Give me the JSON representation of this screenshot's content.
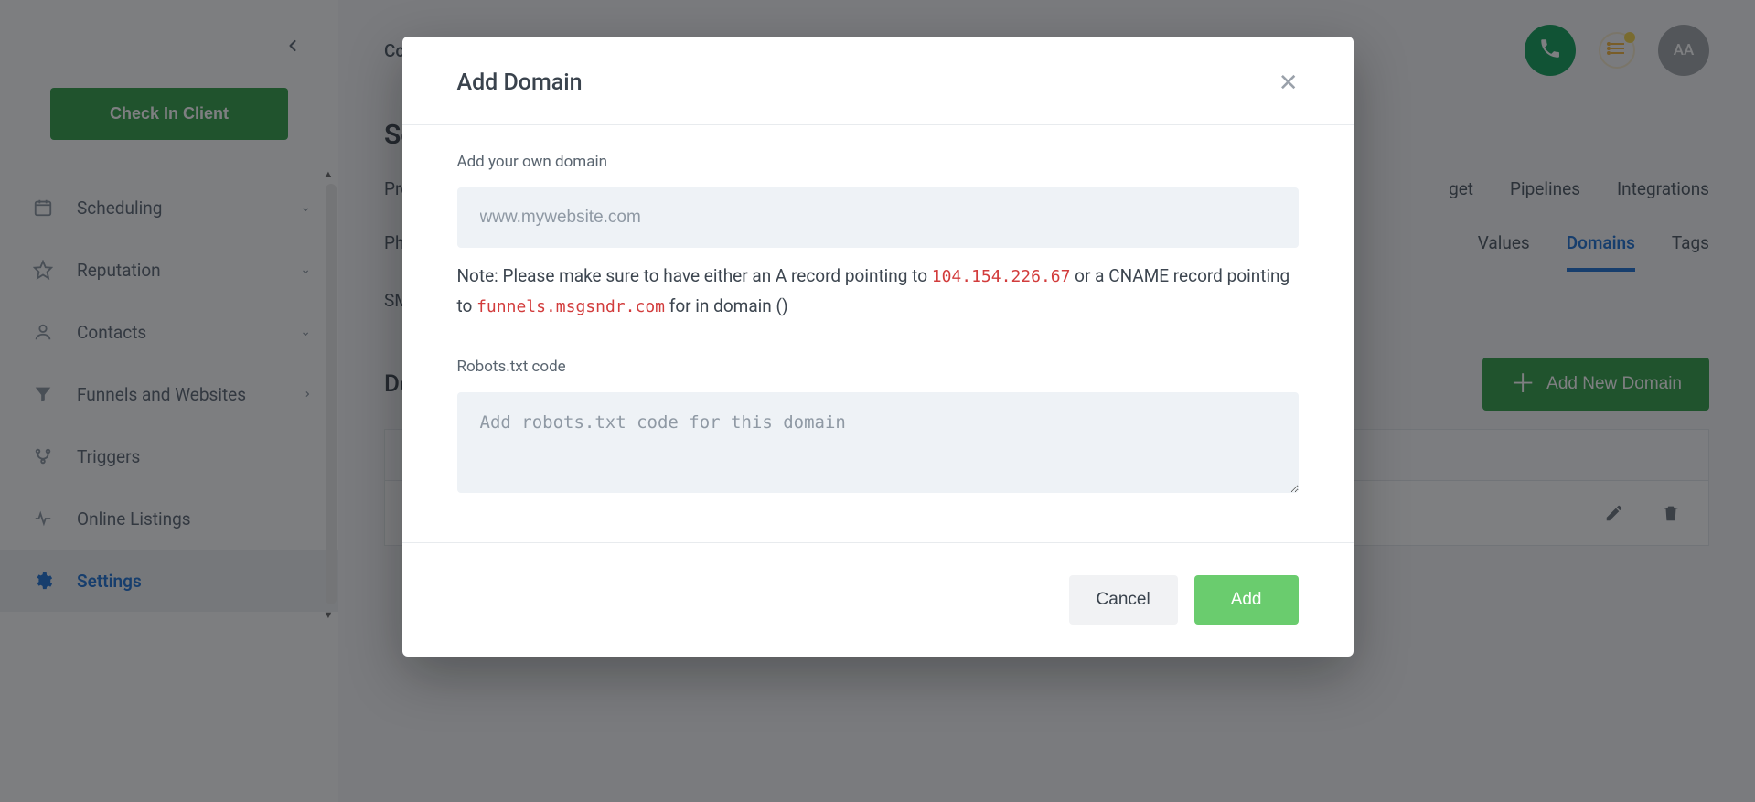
{
  "sidebar": {
    "check_in_label": "Check In Client",
    "items": [
      {
        "icon": "calendar",
        "label": "Scheduling",
        "expandable": true
      },
      {
        "icon": "star",
        "label": "Reputation",
        "expandable": true
      },
      {
        "icon": "person",
        "label": "Contacts",
        "expandable": true
      },
      {
        "icon": "funnel",
        "label": "Funnels and Websites",
        "expandable": true,
        "chevron": "right"
      },
      {
        "icon": "branch",
        "label": "Triggers",
        "expandable": false
      },
      {
        "icon": "pulse",
        "label": "Online Listings",
        "expandable": false
      },
      {
        "icon": "gear",
        "label": "Settings",
        "expandable": false,
        "active": true
      }
    ]
  },
  "header": {
    "breadcrumb": "Co",
    "avatar_initials": "AA"
  },
  "page": {
    "title_prefix": "Set",
    "section_title_prefix": "Do",
    "tabs_row1": [
      "Profi",
      "get",
      "Pipelines",
      "Integrations"
    ],
    "tabs_row2": [
      "Phon",
      " Values",
      "Domains",
      "Tags"
    ],
    "active_tab": "Domains",
    "tabs_row3": [
      "SMT"
    ],
    "add_domain_btn": "Add New Domain"
  },
  "modal": {
    "title": "Add Domain",
    "domain_field_label": "Add your own domain",
    "domain_placeholder": "www.mywebsite.com",
    "note_prefix": "Note: Please make sure to have either an A record pointing to ",
    "note_ip": "104.154.226.67",
    "note_mid": " or a CNAME record pointing to ",
    "note_cname": "funnels.msgsndr.com",
    "note_suffix": " for in domain ()",
    "robots_label": "Robots.txt code",
    "robots_placeholder": "Add robots.txt code for this domain",
    "cancel_label": "Cancel",
    "add_label": "Add"
  }
}
